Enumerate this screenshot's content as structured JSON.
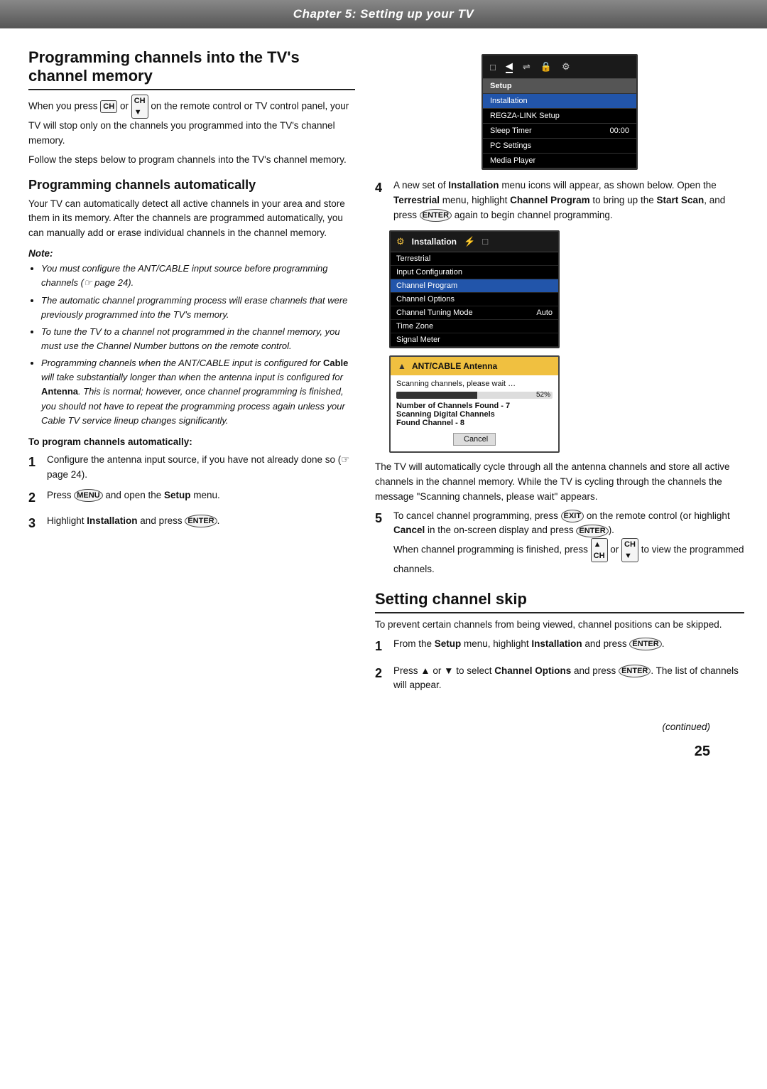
{
  "header": {
    "title": "Chapter 5: Setting up your TV"
  },
  "left": {
    "main_section_title": "Programming channels into the TV's channel memory",
    "intro_text_1": "When you press  or  on the remote control or TV control panel, your TV will stop only on the channels you programmed into the TV's channel memory.",
    "intro_text_2": "Follow the steps below to program channels into the TV's channel memory.",
    "auto_section_title": "Programming channels automatically",
    "auto_text": "Your TV can automatically detect all active channels in your area and store them in its memory. After the channels are programmed automatically, you can manually add or erase individual channels in the channel memory.",
    "note_label": "Note:",
    "notes": [
      "You must configure the ANT/CABLE input source before programming channels (☞ page 24).",
      "The automatic channel programming process will erase channels that were previously programmed into the TV's memory.",
      "To tune the TV to a channel not programmed in the channel memory, you must use the Channel Number buttons on the remote control.",
      "Programming channels when the ANT/CABLE input is configured for Cable will take substantially longer than when the antenna input is configured for Antenna. This is normal; however, once channel programming is finished, you should not have to repeat the programming process again unless your Cable TV service lineup changes significantly."
    ],
    "procedure_title": "To program channels automatically:",
    "steps": [
      {
        "num": "1",
        "text": "Configure the antenna input source, if you have not already done so (☞ page 24)."
      },
      {
        "num": "2",
        "text": "Press  and open the Setup menu."
      },
      {
        "num": "3",
        "text": "Highlight Installation and press ."
      }
    ]
  },
  "right": {
    "tv_menu": {
      "icons": [
        "□",
        "◄",
        "⇌",
        "🔒",
        "⚙"
      ],
      "header_row": "Setup",
      "rows": [
        {
          "label": "Installation",
          "value": ""
        },
        {
          "label": "REGZA-LINK Setup",
          "value": ""
        },
        {
          "label": "Sleep Timer",
          "value": "00:00"
        },
        {
          "label": "PC Settings",
          "value": ""
        },
        {
          "label": "Media Player",
          "value": ""
        }
      ]
    },
    "step4": {
      "num": "4",
      "text_1": "A new set of ",
      "bold_1": "Installation",
      "text_2": " menu icons will appear, as shown below. Open the ",
      "bold_2": "Terrestrial",
      "text_3": " menu, highlight ",
      "bold_3": "Channel Program",
      "text_4": " to bring up the ",
      "bold_4": "Start Scan",
      "text_5": ", and press ",
      "text_6": " again to begin channel programming."
    },
    "install_menu": {
      "rows": [
        {
          "label": "Terrestrial",
          "value": ""
        },
        {
          "label": "Input Configuration",
          "value": ""
        },
        {
          "label": "Channel Program",
          "value": "",
          "highlighted": true
        },
        {
          "label": "Channel Options",
          "value": ""
        },
        {
          "label": "Channel Tuning Mode",
          "value": "Auto"
        },
        {
          "label": "Time Zone",
          "value": ""
        },
        {
          "label": "Signal Meter",
          "value": ""
        }
      ]
    },
    "scan_dialog": {
      "header": "ANT/CABLE  Antenna",
      "scanning_text": "Scanning channels, please wait …",
      "progress_pct": 52,
      "progress_label": "52%",
      "lines": [
        "Number of Channels Found - 7",
        "Scanning Digital Channels",
        "Found Channel - 8"
      ],
      "cancel_btn": "Cancel"
    },
    "tv_cycle_text": "The TV will automatically cycle through all the antenna channels and store all active channels in the channel memory. While the TV is cycling through the channels the message \"Scanning channels, please wait\" appears.",
    "step5": {
      "num": "5",
      "text_1": "To cancel channel programming, press ",
      "text_2": " on the remote control (or highlight ",
      "bold_1": "Cancel",
      "text_3": " in the on-screen display and press ",
      "text_4": ").",
      "text_5": "When channel programming is finished, press  or  to view the programmed channels."
    },
    "skip_section": {
      "title": "Setting channel skip",
      "intro": "To prevent certain channels from being viewed, channel positions can be skipped.",
      "steps": [
        {
          "num": "1",
          "text": "From the Setup menu, highlight Installation and press ."
        },
        {
          "num": "2",
          "text": "Press ▲ or ▼ to select Channel Options and press . The list of channels will appear."
        }
      ]
    }
  },
  "footer": {
    "continued": "(continued)",
    "page_num": "25"
  }
}
